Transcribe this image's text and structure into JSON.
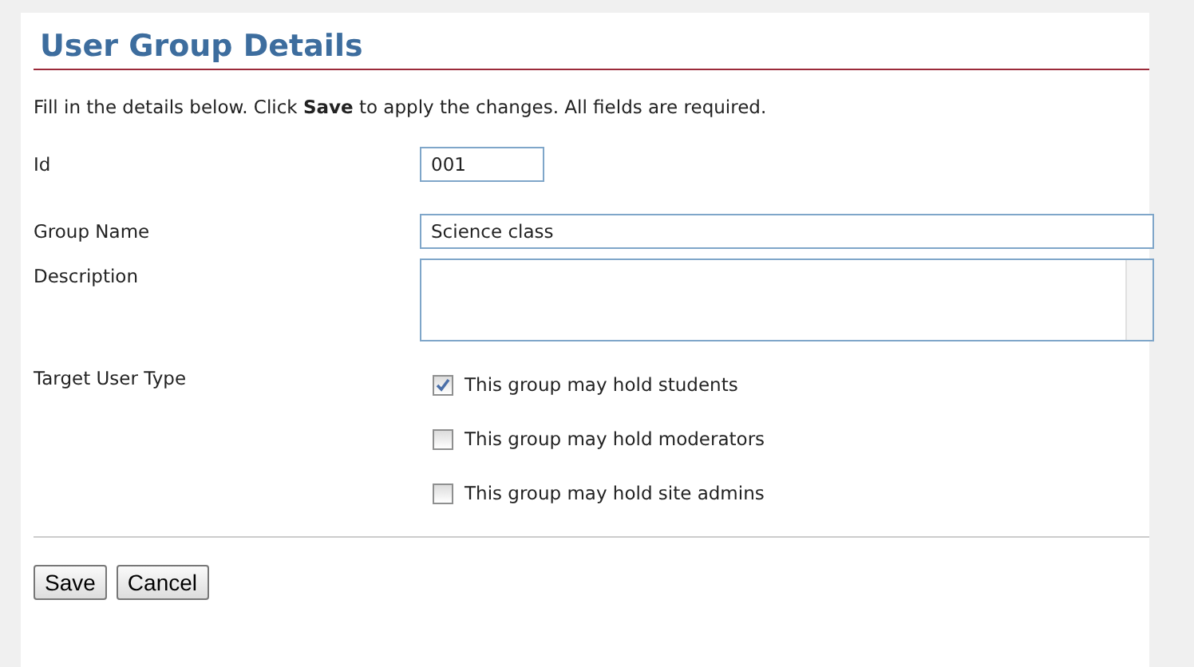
{
  "title": "User Group Details",
  "instructions": "Fill in the details below. Click **Save** to apply the changes. All fields are required.",
  "fields": [
    {
      "label": "Id",
      "kind": "short",
      "value": "001"
    },
    {
      "label": "Group Name",
      "kind": "text",
      "value": "Science class"
    },
    {
      "label": "Description",
      "kind": "textarea"
    }
  ],
  "target_user_type": {
    "label": "Target User Type",
    "options": [
      {
        "label": "This group may hold students",
        "checked": true
      },
      {
        "label": "This group may hold moderators",
        "checked": false
      },
      {
        "label": "This group may hold site admins",
        "checked": false
      }
    ]
  },
  "buttons": [
    "Save",
    "Cancel"
  ]
}
